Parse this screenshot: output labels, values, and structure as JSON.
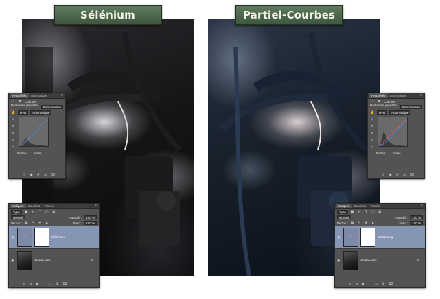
{
  "left": {
    "title": "Sélénium",
    "properties": {
      "tabs": [
        "Propriétés",
        "Informations"
      ],
      "header": "Courbes",
      "preset_label": "Paramètre prédéfini :",
      "preset_value": "Personnalisé",
      "channel": "RVB",
      "auto_button": "Automatique",
      "input_label": "Entrée :",
      "output_label": "Sortie :"
    },
    "layers": {
      "tabs": [
        "Calques",
        "Couches",
        "Tracés"
      ],
      "filter": "Type",
      "blend_mode": "Normal",
      "opacity_label": "Opacité :",
      "opacity_value": "100 %",
      "lock_label": "Verrou :",
      "fill_label": "Fond :",
      "fill_value": "100 %",
      "items": [
        {
          "name": "Sélénium",
          "selected": true,
          "type": "adjustment"
        },
        {
          "name": "Arrière-plan",
          "selected": false,
          "type": "image"
        }
      ]
    }
  },
  "right": {
    "title": "Partiel-Courbes",
    "properties": {
      "tabs": [
        "Propriétés",
        "Informations"
      ],
      "header": "Courbes",
      "preset_label": "Paramètre prédéfini :",
      "preset_value": "Personnalisé",
      "channel": "RVB",
      "auto_button": "Automatique",
      "input_label": "Entrée :",
      "output_label": "Sortie :"
    },
    "layers": {
      "tabs": [
        "Calques",
        "Couches",
        "Tracés"
      ],
      "filter": "Type",
      "blend_mode": "Normal",
      "opacity_label": "Opacité :",
      "opacity_value": "100 %",
      "lock_label": "Verrou :",
      "fill_label": "Fond :",
      "fill_value": "100 %",
      "items": [
        {
          "name": "Split toning",
          "selected": true,
          "type": "adjustment"
        },
        {
          "name": "Arrière-plan",
          "selected": false,
          "type": "image"
        }
      ]
    }
  },
  "colors": {
    "plate_green": "#4e6a4f",
    "panel_bg": "#535353",
    "selected_layer": "#8795b5"
  }
}
